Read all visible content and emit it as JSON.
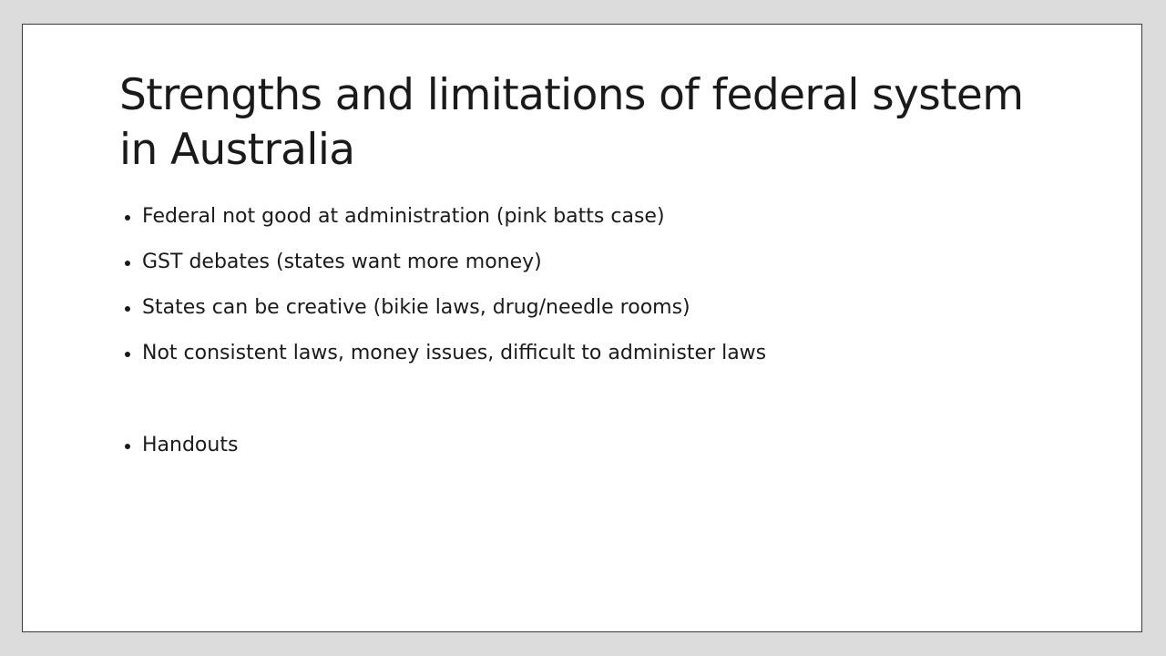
{
  "slide": {
    "title": "Strengths and limitations of federal system in Australia",
    "bullets": [
      "Federal not good at administration (pink batts case)",
      "GST debates (states want more money)",
      "States can be creative (bikie laws, drug/needle rooms)",
      "Not consistent laws, money issues, difficult to administer laws",
      "Handouts"
    ]
  },
  "colors": {
    "background": "#dcdcdc",
    "slide": "#ffffff",
    "text": "#1a1a1a",
    "border": "#3a3a3a"
  },
  "icons": {
    "bullet": "bullet-dot-icon"
  }
}
